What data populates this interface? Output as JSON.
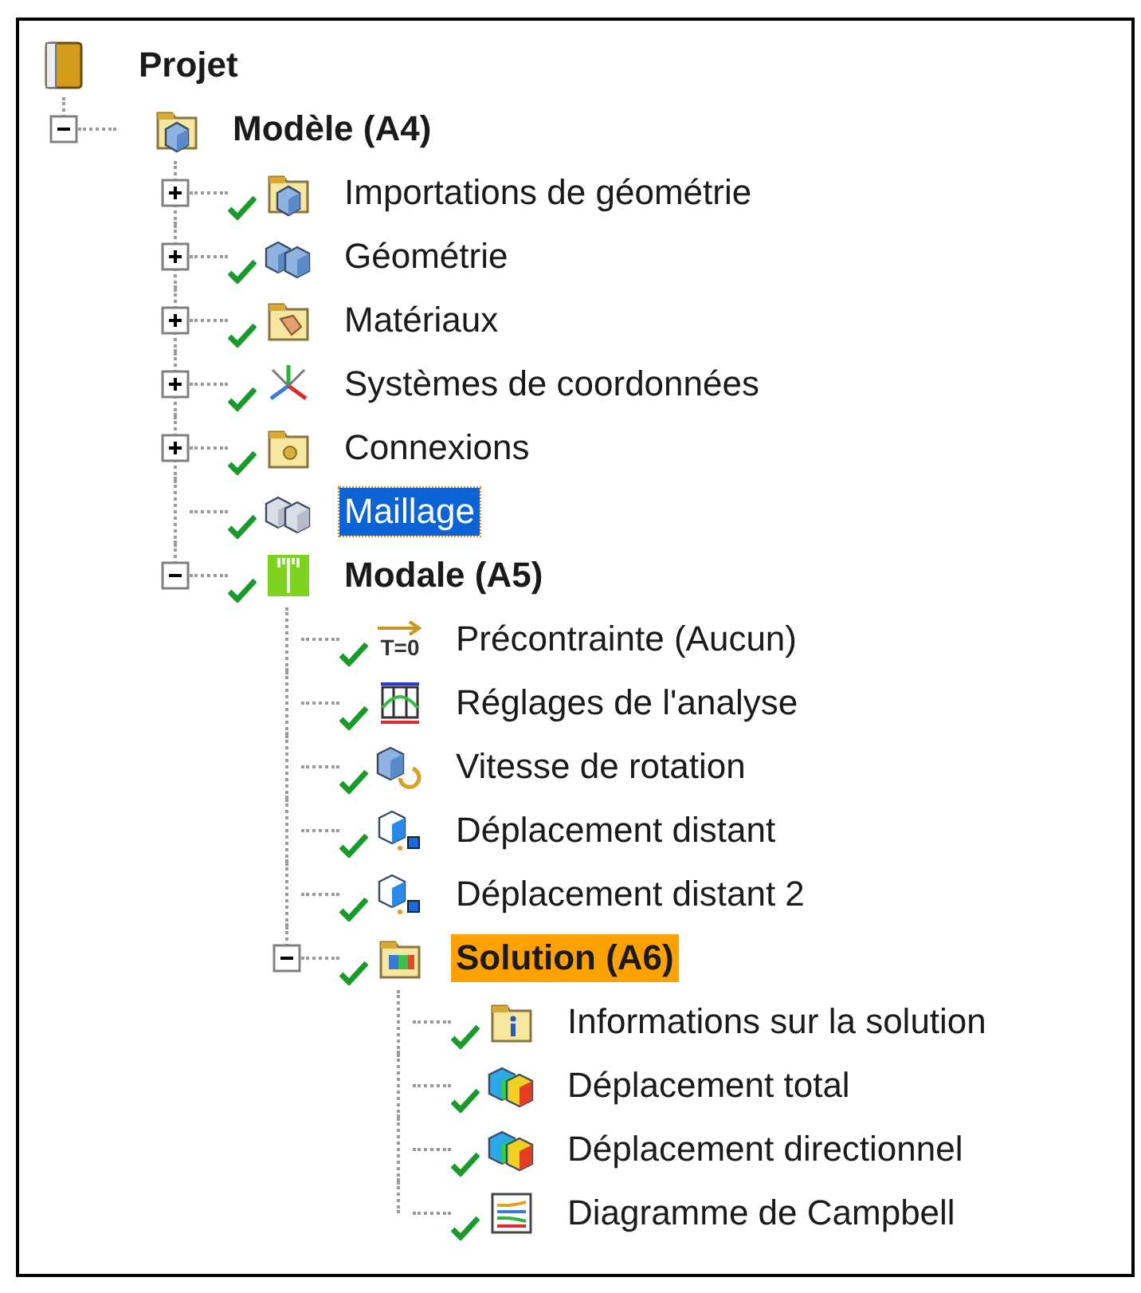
{
  "tree": {
    "label": "Projet",
    "kind": "project",
    "bold": true,
    "selected": false,
    "highlighted": false,
    "children": [
      {
        "label": "Modèle (A4)",
        "kind": "model",
        "bold": true,
        "expanded": true,
        "selected": false,
        "highlighted": false,
        "children": [
          {
            "label": "Importations de géométrie",
            "kind": "import",
            "bold": false,
            "done": true,
            "expanded": false,
            "selected": false,
            "highlighted": false
          },
          {
            "label": "Géométrie",
            "kind": "geometry",
            "bold": false,
            "done": true,
            "expanded": false,
            "selected": false,
            "highlighted": false
          },
          {
            "label": "Matériaux",
            "kind": "materials",
            "bold": false,
            "done": true,
            "expanded": false,
            "selected": false,
            "highlighted": false
          },
          {
            "label": "Systèmes de coordonnées",
            "kind": "coordinates",
            "bold": false,
            "done": true,
            "expanded": false,
            "selected": false,
            "highlighted": false
          },
          {
            "label": "Connexions",
            "kind": "connections",
            "bold": false,
            "done": true,
            "expanded": false,
            "selected": false,
            "highlighted": false
          },
          {
            "label": "Maillage",
            "kind": "mesh",
            "bold": false,
            "done": true,
            "selected": true
          },
          {
            "label": "Modale (A5)",
            "kind": "modal",
            "bold": true,
            "done": true,
            "expanded": true,
            "selected": false,
            "highlighted": false,
            "children": [
              {
                "label": "Précontrainte (Aucun)",
                "kind": "preload",
                "icon_text": "T=0",
                "bold": false,
                "done": true,
                "selected": false,
                "highlighted": false
              },
              {
                "label": "Réglages de l'analyse",
                "kind": "settings",
                "bold": false,
                "done": true,
                "selected": false,
                "highlighted": false
              },
              {
                "label": "Vitesse de rotation",
                "kind": "rotation",
                "bold": false,
                "done": true,
                "selected": false,
                "highlighted": false
              },
              {
                "label": "Déplacement distant",
                "kind": "remote",
                "bold": false,
                "done": true,
                "selected": false,
                "highlighted": false
              },
              {
                "label": "Déplacement distant 2",
                "kind": "remote",
                "bold": false,
                "done": true,
                "selected": false,
                "highlighted": false
              },
              {
                "label": "Solution (A6)",
                "kind": "solution",
                "bold": true,
                "done": true,
                "expanded": true,
                "selected": false,
                "highlighted": true,
                "children": [
                  {
                    "label": "Informations sur la solution",
                    "kind": "info",
                    "bold": false,
                    "done": true,
                    "selected": false,
                    "highlighted": false
                  },
                  {
                    "label": "Déplacement total",
                    "kind": "result",
                    "bold": false,
                    "done": true,
                    "selected": false,
                    "highlighted": false
                  },
                  {
                    "label": "Déplacement directionnel",
                    "kind": "result",
                    "bold": false,
                    "done": true,
                    "selected": false,
                    "highlighted": false
                  },
                  {
                    "label": "Diagramme de Campbell",
                    "kind": "campbell",
                    "bold": false,
                    "done": true,
                    "selected": false,
                    "highlighted": false
                  }
                ]
              }
            ]
          }
        ]
      }
    ]
  }
}
